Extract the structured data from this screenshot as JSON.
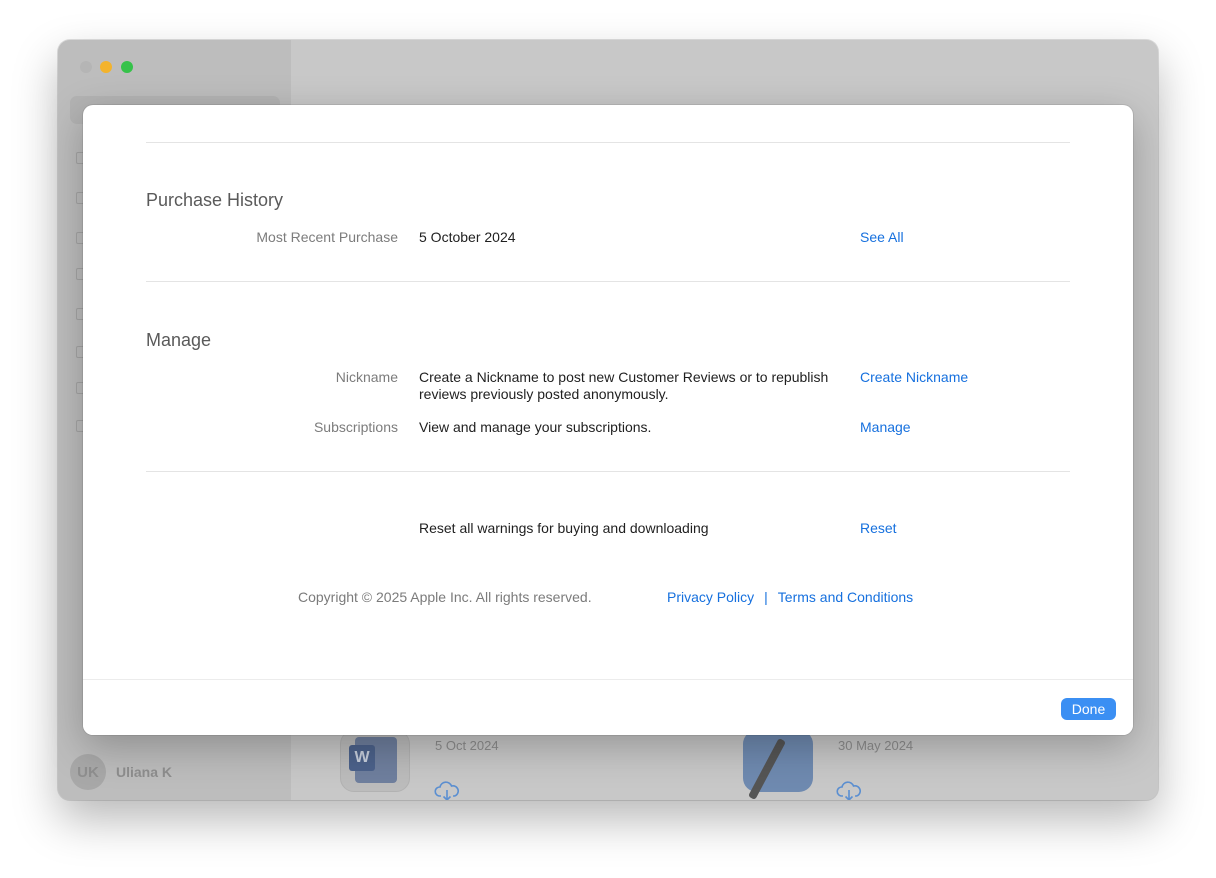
{
  "background": {
    "user": {
      "initials": "UK",
      "name": "Uliana K"
    },
    "apps": [
      {
        "date": "5 Oct 2024",
        "icon": "microsoft-word-icon",
        "letter": "W"
      },
      {
        "date": "30 May 2024",
        "icon": "xcode-icon"
      }
    ]
  },
  "dialog": {
    "purchase_history": {
      "title": "Purchase History",
      "label": "Most Recent Purchase",
      "value": "5 October 2024",
      "link": "See All"
    },
    "manage": {
      "title": "Manage",
      "nickname": {
        "label": "Nickname",
        "value": "Create a Nickname to post new Customer Reviews or to republish reviews previously posted anonymously.",
        "link": "Create Nickname"
      },
      "subscriptions": {
        "label": "Subscriptions",
        "value": "View and manage your subscriptions.",
        "link": "Manage"
      }
    },
    "reset": {
      "value": "Reset all warnings for buying and downloading",
      "link": "Reset"
    },
    "footer": {
      "copyright": "Copyright © 2025 Apple Inc. All rights reserved.",
      "privacy": "Privacy Policy",
      "separator": "|",
      "terms": "Terms and Conditions"
    },
    "done_label": "Done"
  },
  "colors": {
    "link": "#1670de",
    "done_button": "#3b8ff3"
  }
}
